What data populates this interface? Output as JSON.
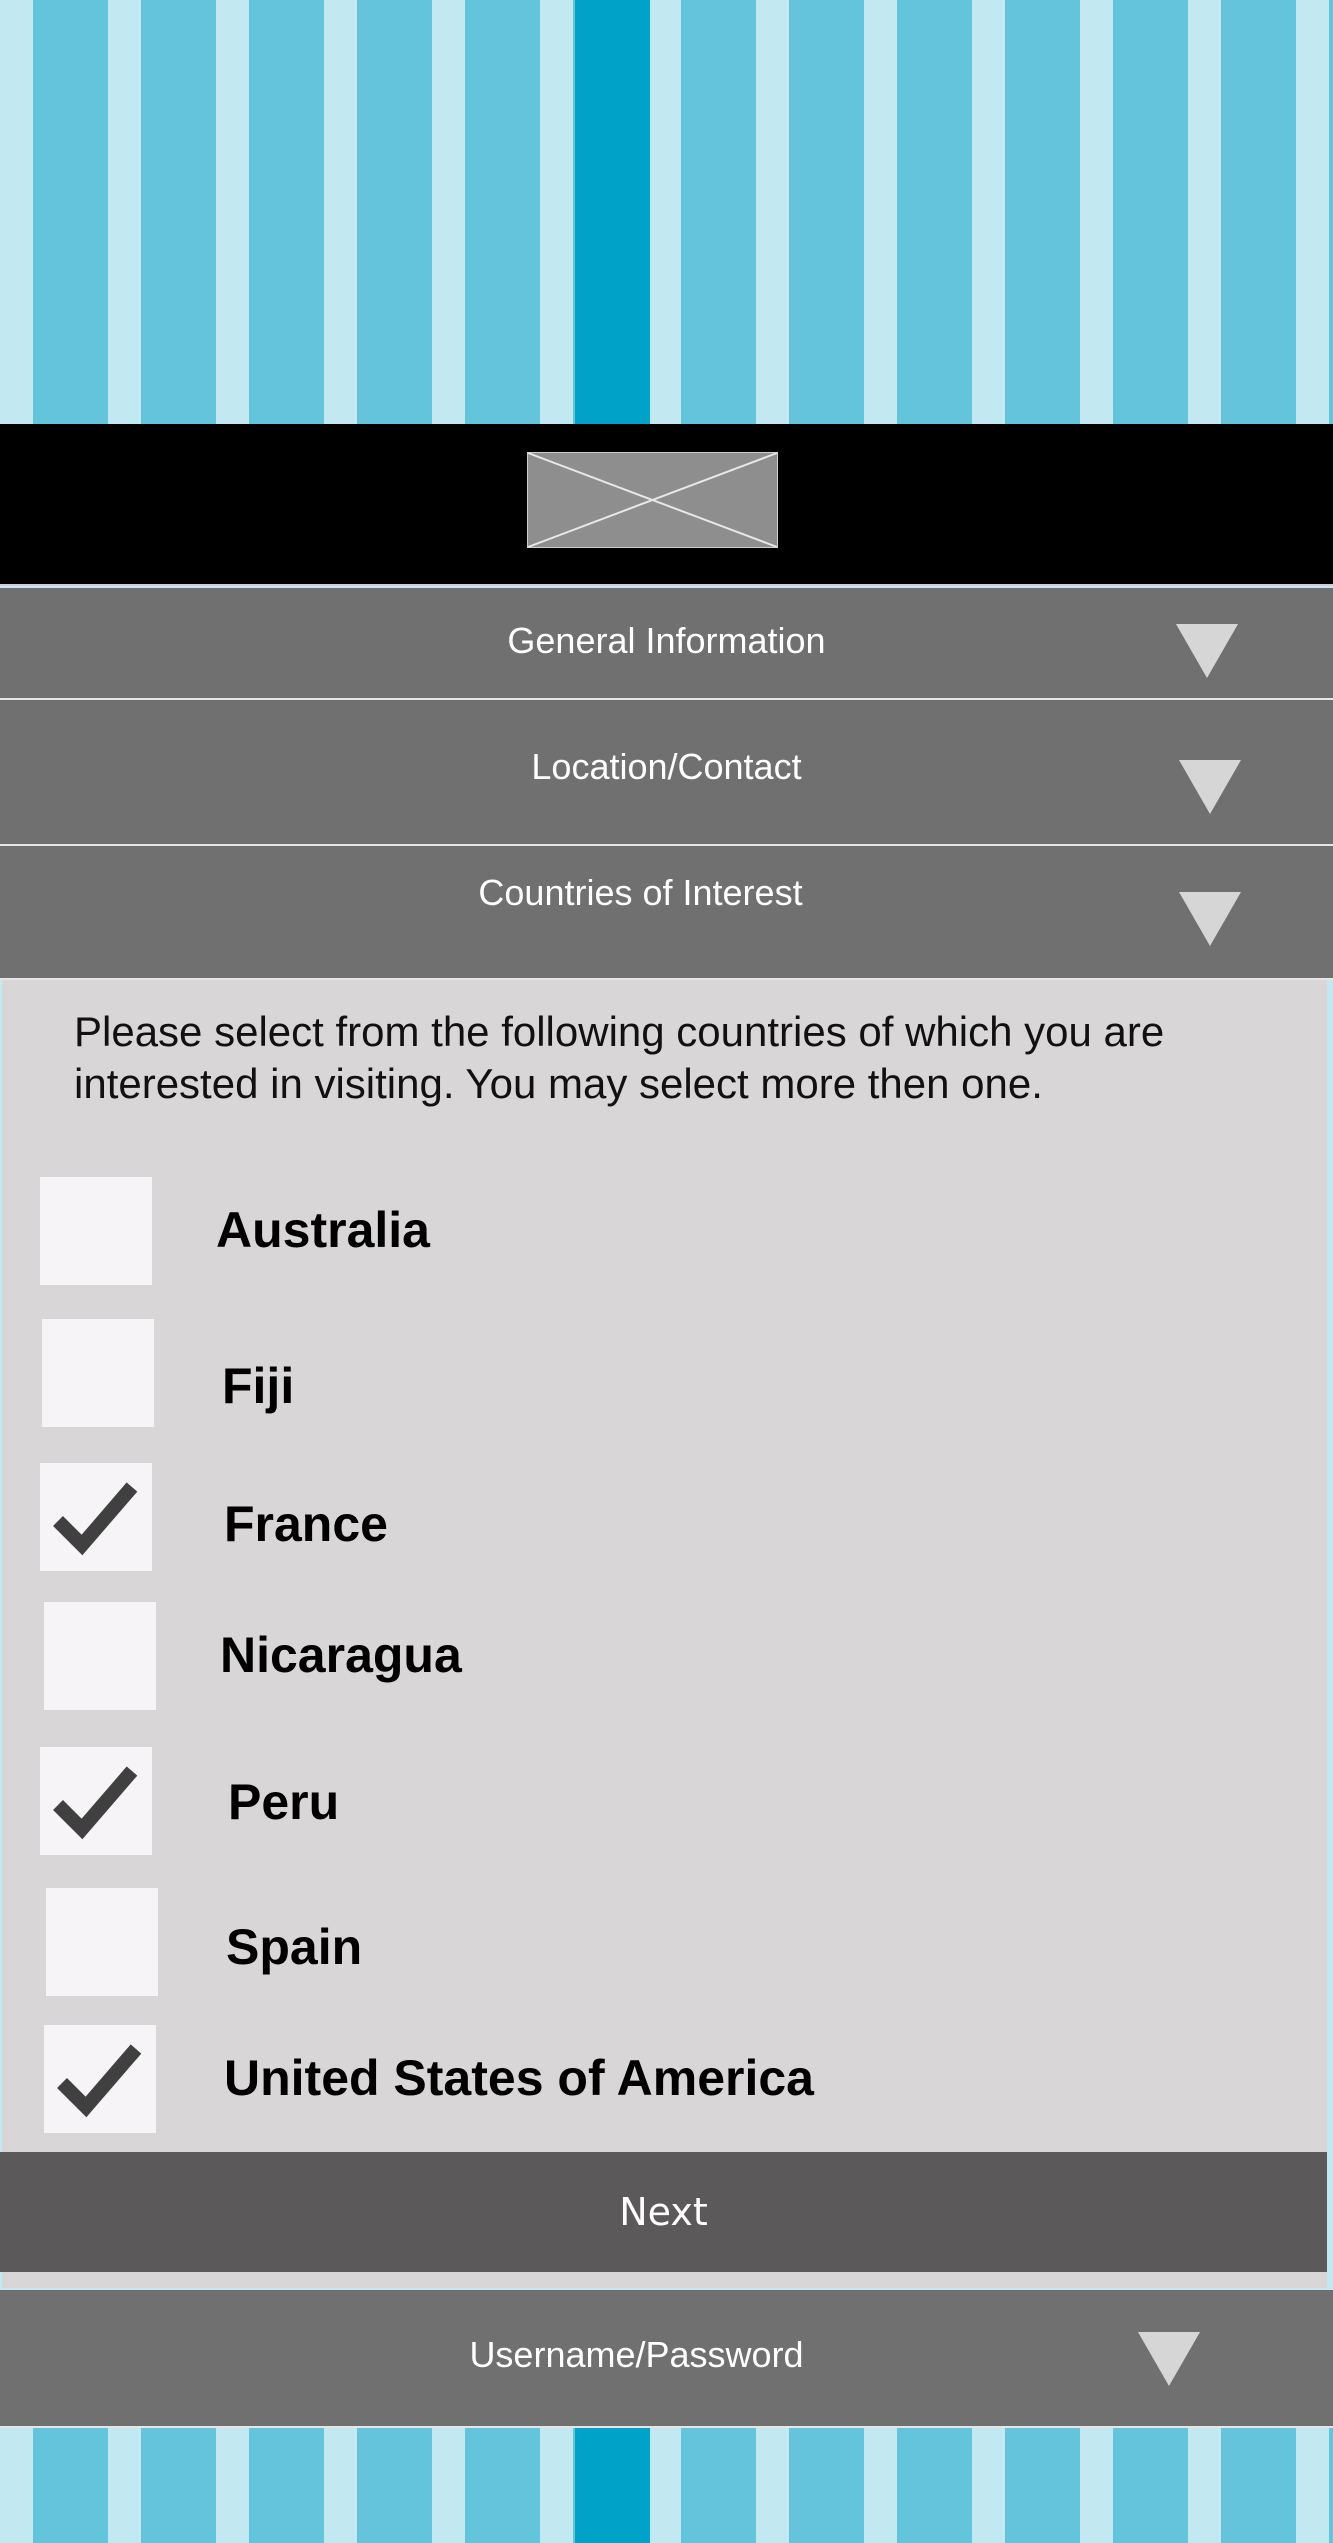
{
  "header": {
    "logo_alt": "logo-placeholder",
    "colors": {
      "stripe_light": "#c2e8f1",
      "stripe_mid": "#63c4dc",
      "stripe_accent": "#00a2c7",
      "bar": "#000000"
    }
  },
  "sections": {
    "general": {
      "label": "General Information",
      "icon": "chevron-down-triangle-icon"
    },
    "location": {
      "label": "Location/Contact",
      "icon": "chevron-down-triangle-icon"
    },
    "countries": {
      "label": "Countries of Interest",
      "icon": "chevron-down-triangle-icon"
    },
    "username": {
      "label": "Username/Password",
      "icon": "chevron-down-triangle-icon"
    }
  },
  "countries_panel": {
    "intro_line1": "Please select from the following countries of which you are",
    "intro_line2": "interested in visiting. You may select more then one.",
    "items": [
      {
        "name": "Australia",
        "checked": false
      },
      {
        "name": "Fiji",
        "checked": false
      },
      {
        "name": "France",
        "checked": true
      },
      {
        "name": "Nicaragua",
        "checked": false
      },
      {
        "name": "Peru",
        "checked": true
      },
      {
        "name": "Spain",
        "checked": false
      },
      {
        "name": "United States of America",
        "checked": true
      }
    ]
  },
  "actions": {
    "next_label": "Next"
  }
}
